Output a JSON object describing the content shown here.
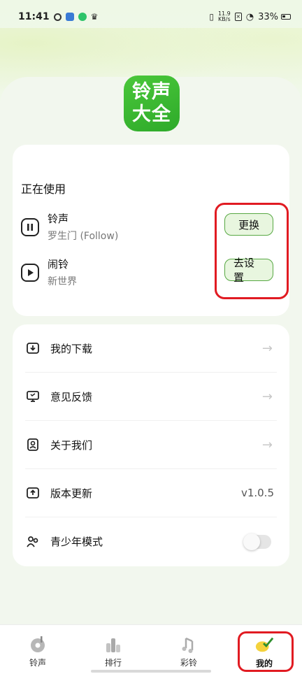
{
  "status_bar": {
    "time": "11:41",
    "speed_value": "11.9",
    "speed_unit": "KB/s",
    "battery": "33%"
  },
  "app": {
    "logo_line1": "铃声",
    "logo_line2": "大全"
  },
  "now_using": {
    "title": "正在使用",
    "ringtone": {
      "label": "铃声",
      "value": "罗生门 (Follow)",
      "button": "更换"
    },
    "alarm": {
      "label": "闹铃",
      "value": "新世界",
      "button": "去设置"
    }
  },
  "menu": {
    "downloads": "我的下载",
    "feedback": "意见反馈",
    "about": "关于我们",
    "update": "版本更新",
    "version": "v1.0.5",
    "teen_mode": "青少年模式"
  },
  "tabs": {
    "ringtone": "铃声",
    "ranking": "排行",
    "color_ring": "彩铃",
    "mine": "我的"
  },
  "colors": {
    "accent": "#57a843",
    "logo": "#3ab82f",
    "highlight": "#e11b22"
  }
}
